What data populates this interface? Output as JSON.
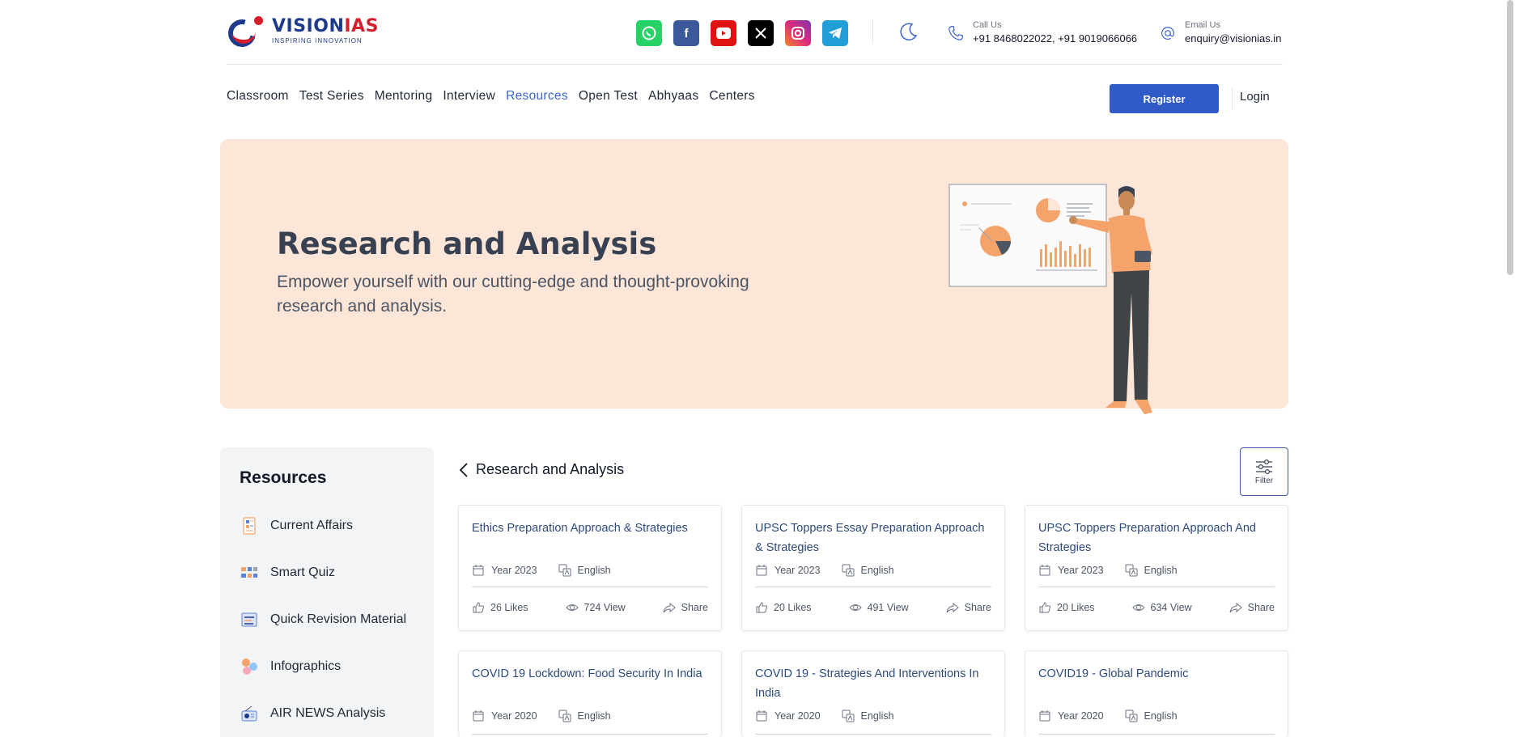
{
  "brand": {
    "name_part1": "VISION",
    "name_part2": "IAS",
    "tagline": "INSPIRING INNOVATION",
    "primary_color": "#1e3a8a",
    "accent_color": "#d61f2c"
  },
  "socials": [
    {
      "name": "whatsapp",
      "glyph": "✆"
    },
    {
      "name": "facebook",
      "glyph": "f"
    },
    {
      "name": "youtube",
      "glyph": "▶"
    },
    {
      "name": "x",
      "glyph": "𝕏"
    },
    {
      "name": "instagram",
      "glyph": "◎"
    },
    {
      "name": "telegram",
      "glyph": "➤"
    }
  ],
  "contact": {
    "call_label": "Call Us",
    "call_value": "+91 8468022022, +91 9019066066",
    "email_label": "Email Us",
    "email_value": "enquiry@visionias.in"
  },
  "nav": {
    "items": [
      "Classroom",
      "Test Series",
      "Mentoring",
      "Interview",
      "Resources",
      "Open Test",
      "Abhyaas",
      "Centers"
    ],
    "active": "Resources",
    "register_label": "Register",
    "login_label": "Login",
    "accent_color": "#2f5ac7"
  },
  "hero": {
    "title": "Research and Analysis",
    "subtitle": "Empower yourself with our cutting-edge and thought-provoking research and analysis.",
    "bg_color": "#fde5d7"
  },
  "sidebar": {
    "title": "Resources",
    "items": [
      {
        "label": "Current Affairs",
        "icon": "newspaper-icon"
      },
      {
        "label": "Smart Quiz",
        "icon": "quiz-icon"
      },
      {
        "label": "Quick Revision Material",
        "icon": "revision-icon"
      },
      {
        "label": "Infographics",
        "icon": "infographics-icon"
      },
      {
        "label": "AIR NEWS Analysis",
        "icon": "radio-icon"
      }
    ]
  },
  "content": {
    "back_title": "Research and Analysis",
    "filter_label": "Filter",
    "cards": [
      {
        "title": "Ethics Preparation Approach & Strategies",
        "year": "Year 2023",
        "language": "English",
        "likes": "26 Likes",
        "views": "724 View",
        "share": "Share"
      },
      {
        "title": "UPSC Toppers Essay Preparation Approach & Strategies",
        "year": "Year 2023",
        "language": "English",
        "likes": "20 Likes",
        "views": "491 View",
        "share": "Share"
      },
      {
        "title": "UPSC Toppers Preparation Approach And Strategies",
        "year": "Year 2023",
        "language": "English",
        "likes": "20 Likes",
        "views": "634 View",
        "share": "Share"
      },
      {
        "title": "COVID 19 Lockdown: Food Security In India",
        "year": "Year 2020",
        "language": "English"
      },
      {
        "title": "COVID 19 - Strategies And Interventions In India",
        "year": "Year 2020",
        "language": "English"
      },
      {
        "title": "COVID19 - Global Pandemic",
        "year": "Year 2020",
        "language": "English"
      }
    ]
  }
}
